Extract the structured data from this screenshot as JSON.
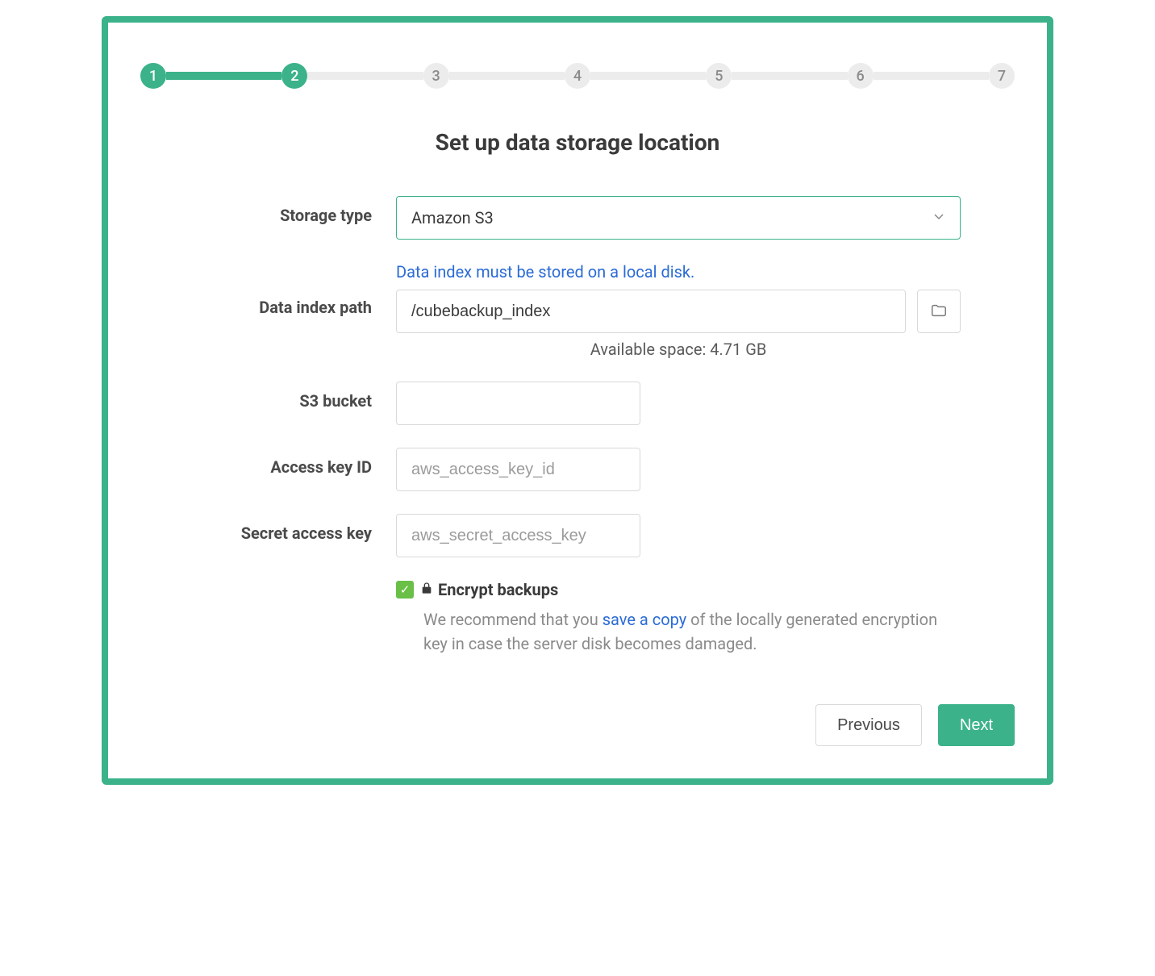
{
  "stepper": {
    "current": 2,
    "steps": [
      "1",
      "2",
      "3",
      "4",
      "5",
      "6",
      "7"
    ]
  },
  "title": "Set up data storage location",
  "form": {
    "storage_type": {
      "label": "Storage type",
      "value": "Amazon S3"
    },
    "data_index": {
      "label": "Data index path",
      "hint": "Data index must be stored on a local disk.",
      "value": "/cubebackup_index",
      "available_space": "Available space: 4.71 GB"
    },
    "s3_bucket": {
      "label": "S3 bucket",
      "value": ""
    },
    "access_key": {
      "label": "Access key ID",
      "placeholder": "aws_access_key_id",
      "value": ""
    },
    "secret_key": {
      "label": "Secret access key",
      "placeholder": "aws_secret_access_key",
      "value": ""
    },
    "encrypt": {
      "label": "Encrypt backups",
      "checked": true,
      "recommend_pre": "We recommend that you ",
      "recommend_link": "save a copy",
      "recommend_post": " of the locally generated encryption key in case the server disk becomes damaged."
    }
  },
  "buttons": {
    "previous": "Previous",
    "next": "Next"
  }
}
